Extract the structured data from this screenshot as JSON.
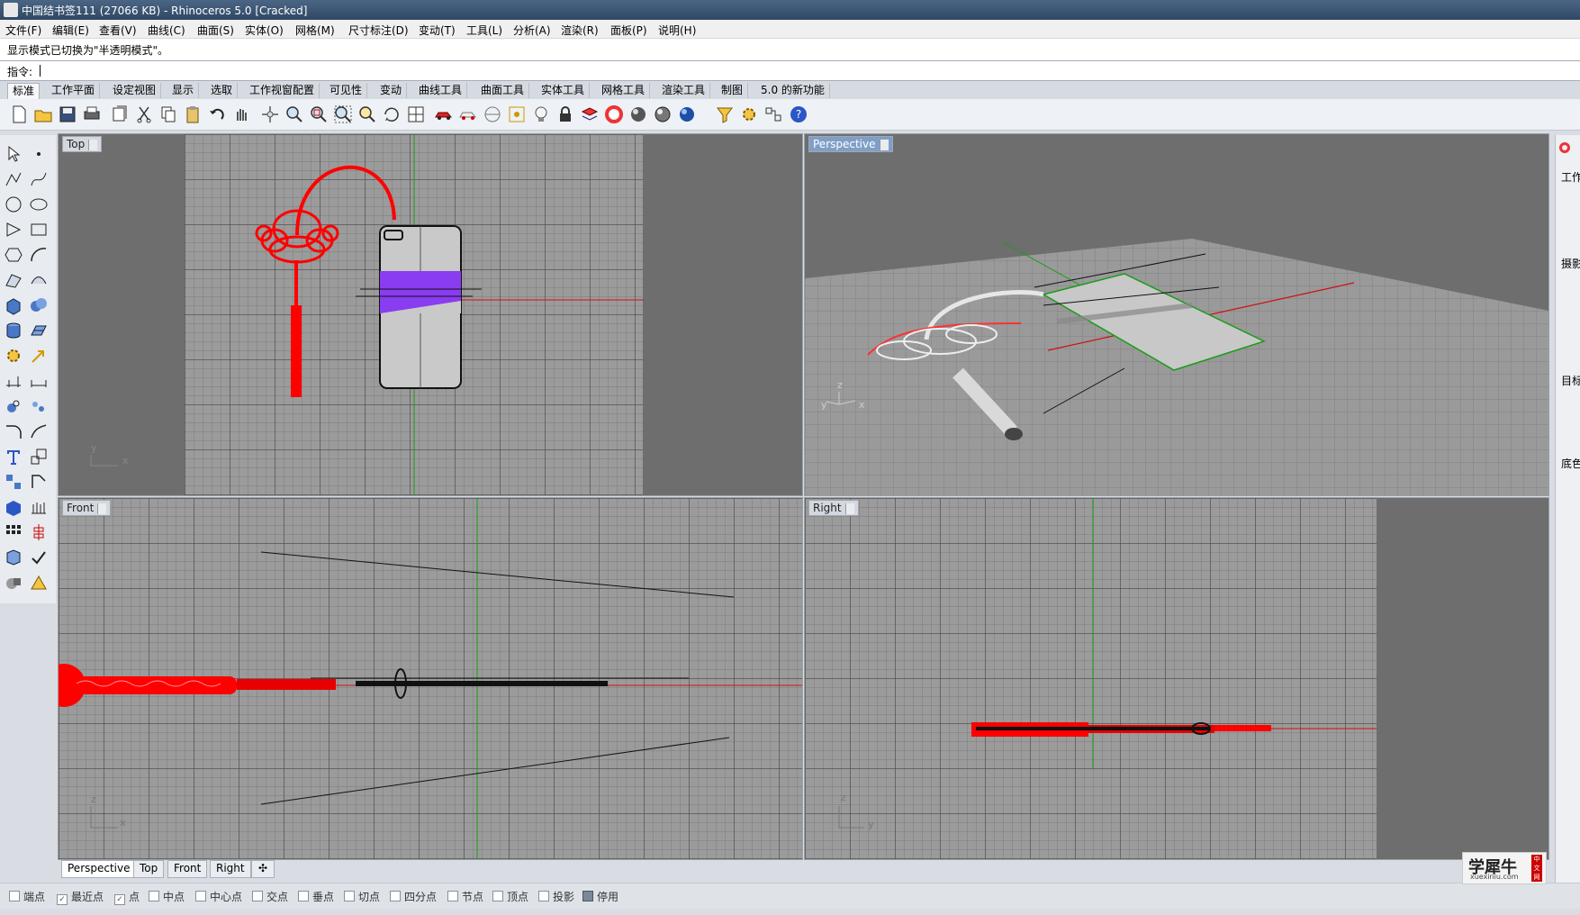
{
  "window": {
    "title": "中国结书签111 (27066 KB) - Rhinoceros 5.0 [Cracked]"
  },
  "menu": [
    "文件(F)",
    "编辑(E)",
    "查看(V)",
    "曲线(C)",
    "曲面(S)",
    "实体(O)",
    "网格(M)",
    "尺寸标注(D)",
    "变动(T)",
    "工具(L)",
    "分析(A)",
    "渲染(R)",
    "面板(P)",
    "说明(H)"
  ],
  "command": {
    "message": "显示模式已切换为\"半透明模式\"。",
    "prompt": "指令:"
  },
  "toolbar_tabs": [
    "标准",
    "工作平面",
    "设定视图",
    "显示",
    "选取",
    "工作视窗配置",
    "可见性",
    "变动",
    "曲线工具",
    "曲面工具",
    "实体工具",
    "网格工具",
    "渲染工具",
    "制图",
    "5.0 的新功能"
  ],
  "viewports": {
    "top": {
      "label": "Top"
    },
    "perspective": {
      "label": "Perspective"
    },
    "front": {
      "label": "Front"
    },
    "right": {
      "label": "Right"
    }
  },
  "axes": {
    "top_x": "x",
    "top_y": "y",
    "persp_z": "z",
    "persp_y": "y",
    "persp_x": "x",
    "front_z": "z",
    "front_x": "x",
    "right_z": "z",
    "right_y": "y"
  },
  "viewport_tabs": [
    "Perspective",
    "Top",
    "Front",
    "Right"
  ],
  "osnap": [
    {
      "label": "端点",
      "checked": false
    },
    {
      "label": "最近点",
      "checked": true
    },
    {
      "label": "点",
      "checked": true
    },
    {
      "label": "中点",
      "checked": false
    },
    {
      "label": "中心点",
      "checked": false
    },
    {
      "label": "交点",
      "checked": false
    },
    {
      "label": "垂点",
      "checked": false
    },
    {
      "label": "切点",
      "checked": false
    },
    {
      "label": "四分点",
      "checked": false
    },
    {
      "label": "节点",
      "checked": false
    },
    {
      "label": "顶点",
      "checked": false
    },
    {
      "label": "投影",
      "checked": false
    },
    {
      "label": "停用",
      "checked": false
    }
  ],
  "right_panel": {
    "labels": [
      "工作",
      "摄影",
      "目标",
      "底色"
    ]
  },
  "watermark": {
    "title": "学犀牛",
    "url": "xuexiniu.com",
    "badge": "中文网"
  },
  "colors": {
    "accent": "#7f9fc8",
    "knot": "#ff0000",
    "band": "#8a3cf0"
  }
}
